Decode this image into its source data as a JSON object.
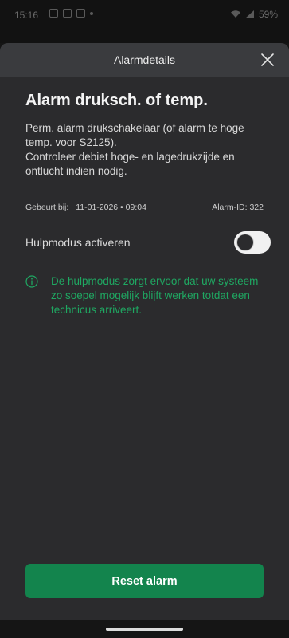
{
  "status_bar": {
    "time": "15:16",
    "battery": "59%",
    "left_icons": [
      "signal-icon",
      "message-icon",
      "mail-icon"
    ],
    "right_icons": [
      "wifi-icon",
      "signal-bars-icon",
      "battery-icon"
    ]
  },
  "sheet": {
    "title": "Alarmdetails",
    "close_icon": "close-icon"
  },
  "alarm": {
    "title": "Alarm druksch. of temp.",
    "description_line1": "Perm. alarm drukschakelaar (of alarm te hoge temp. voor S2125).",
    "description_line2": "Controleer debiet hoge- en lagedrukzijde en ontlucht indien nodig.",
    "occurred_label": "Gebeurt bij:",
    "occurred_value": "11-01-2026 • 09:04",
    "alarm_id": "Alarm-ID: 322"
  },
  "help_mode": {
    "label": "Hulpmodus activeren",
    "enabled": false,
    "info_icon": "info-icon",
    "info_text": "De hulpmodus zorgt ervoor dat uw systeem zo soepel mogelijk blijft werken totdat een technicus arriveert."
  },
  "actions": {
    "reset_label": "Reset alarm"
  },
  "colors": {
    "accent_green": "#13844d",
    "info_green": "#1fa862",
    "sheet_background": "#2b2b2d",
    "header_background": "#3a3b3e"
  }
}
